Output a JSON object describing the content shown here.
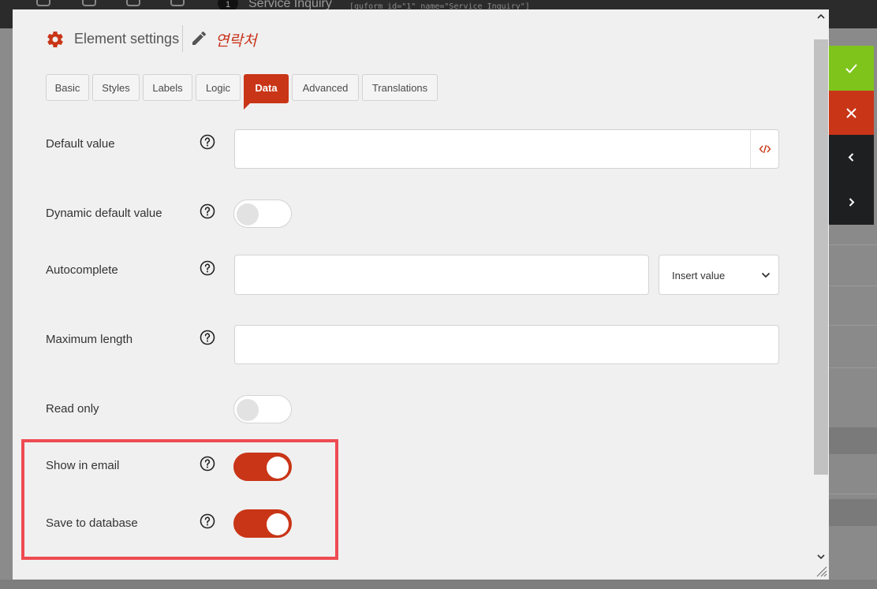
{
  "background": {
    "form_number": "1",
    "form_title": "Service Inquiry",
    "shortcode": "[quform id=\"1\" name=\"Service Inquiry\"]"
  },
  "header": {
    "title": "Element settings",
    "element_name": "연락처"
  },
  "tabs": [
    {
      "label": "Basic",
      "active": false
    },
    {
      "label": "Styles",
      "active": false
    },
    {
      "label": "Labels",
      "active": false
    },
    {
      "label": "Logic",
      "active": false
    },
    {
      "label": "Data",
      "active": true
    },
    {
      "label": "Advanced",
      "active": false
    },
    {
      "label": "Translations",
      "active": false
    }
  ],
  "fields": {
    "default_value": {
      "label": "Default value",
      "value": ""
    },
    "dynamic_default_value": {
      "label": "Dynamic default value",
      "enabled": false
    },
    "autocomplete": {
      "label": "Autocomplete",
      "value": "",
      "select_value": "Insert value"
    },
    "maximum_length": {
      "label": "Maximum length",
      "value": ""
    },
    "read_only": {
      "label": "Read only",
      "enabled": false
    },
    "show_in_email": {
      "label": "Show in email",
      "enabled": true
    },
    "save_to_database": {
      "label": "Save to database",
      "enabled": true
    }
  },
  "colors": {
    "accent": "#c93517",
    "confirm": "#7fc41a",
    "highlight": "#ee4b52"
  },
  "side_actions": [
    "check-icon",
    "close-icon",
    "chevron-left-icon",
    "chevron-right-icon"
  ]
}
